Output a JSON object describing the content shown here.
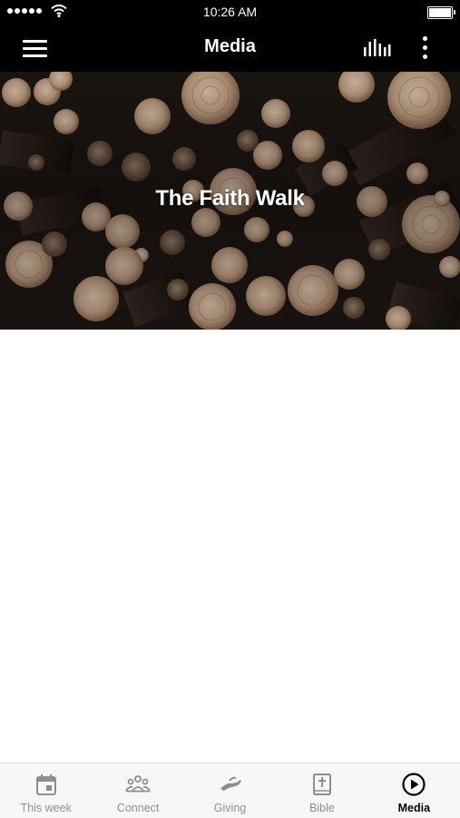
{
  "status_bar": {
    "time": "10:26 AM"
  },
  "nav": {
    "title": "Media",
    "menu_icon": "hamburger-menu-icon",
    "audio_icon": "audio-bars-icon",
    "more_icon": "more-vertical-icon"
  },
  "hero": {
    "title": "The Faith Walk",
    "image": "stacked-logs-photo"
  },
  "tabs": [
    {
      "label": "This week",
      "icon": "calendar-icon",
      "active": false
    },
    {
      "label": "Connect",
      "icon": "people-group-icon",
      "active": false
    },
    {
      "label": "Giving",
      "icon": "giving-hand-icon",
      "active": false
    },
    {
      "label": "Bible",
      "icon": "bible-icon",
      "active": false
    },
    {
      "label": "Media",
      "icon": "play-circle-icon",
      "active": true
    }
  ],
  "colors": {
    "bar_background": "#000000",
    "tab_inactive": "#8e8e8e",
    "tab_active": "#000000"
  }
}
